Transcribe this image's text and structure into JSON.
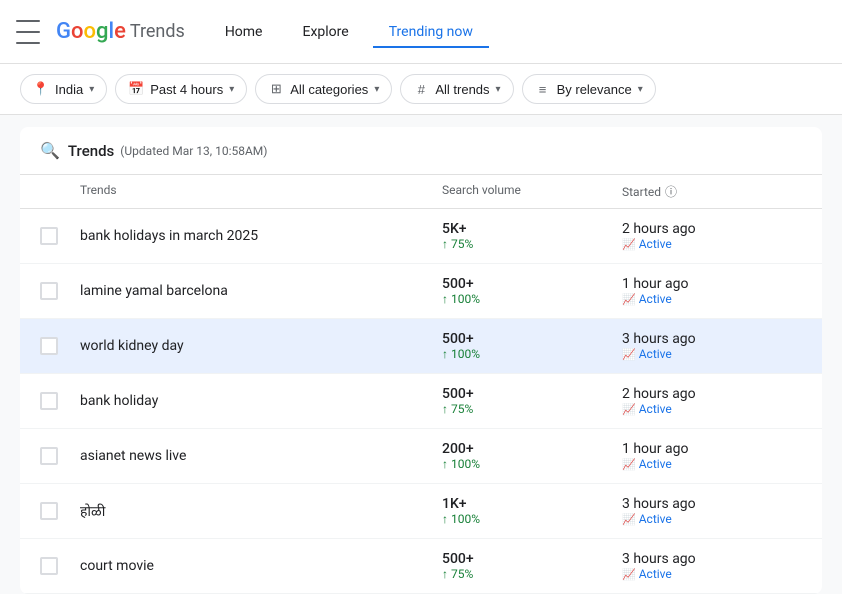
{
  "header": {
    "menu_icon": "hamburger-menu",
    "logo_text": "Google",
    "logo_suffix": "Trends",
    "nav": [
      {
        "label": "Home",
        "active": false
      },
      {
        "label": "Explore",
        "active": false
      },
      {
        "label": "Trending now",
        "active": true
      }
    ]
  },
  "filters": [
    {
      "icon": "location-pin",
      "label": "India",
      "id": "filter-country"
    },
    {
      "icon": "calendar",
      "label": "Past 4 hours",
      "id": "filter-time"
    },
    {
      "icon": "grid",
      "label": "All categories",
      "id": "filter-categories"
    },
    {
      "icon": "hashtag",
      "label": "All trends",
      "id": "filter-trends"
    },
    {
      "icon": "sort",
      "label": "By relevance",
      "id": "filter-sort"
    }
  ],
  "table": {
    "title": "Trends",
    "updated": "(Updated Mar 13, 10:58AM)",
    "columns": {
      "trend": "Trends",
      "volume": "Search volume",
      "started": "Started",
      "info_icon": "info-circle"
    },
    "rows": [
      {
        "name": "bank holidays in march 2025",
        "volume": "5K+",
        "volume_change": "↑ 75%",
        "started": "2 hours ago",
        "status": "Active",
        "highlighted": false
      },
      {
        "name": "lamine yamal barcelona",
        "volume": "500+",
        "volume_change": "↑ 100%",
        "started": "1 hour ago",
        "status": "Active",
        "highlighted": false
      },
      {
        "name": "world kidney day",
        "volume": "500+",
        "volume_change": "↑ 100%",
        "started": "3 hours ago",
        "status": "Active",
        "highlighted": true
      },
      {
        "name": "bank holiday",
        "volume": "500+",
        "volume_change": "↑ 75%",
        "started": "2 hours ago",
        "status": "Active",
        "highlighted": false
      },
      {
        "name": "asianet news live",
        "volume": "200+",
        "volume_change": "↑ 100%",
        "started": "1 hour ago",
        "status": "Active",
        "highlighted": false
      },
      {
        "name": "होळी",
        "volume": "1K+",
        "volume_change": "↑ 100%",
        "started": "3 hours ago",
        "status": "Active",
        "highlighted": false
      },
      {
        "name": "court movie",
        "volume": "500+",
        "volume_change": "↑ 75%",
        "started": "3 hours ago",
        "status": "Active",
        "highlighted": false
      }
    ]
  }
}
